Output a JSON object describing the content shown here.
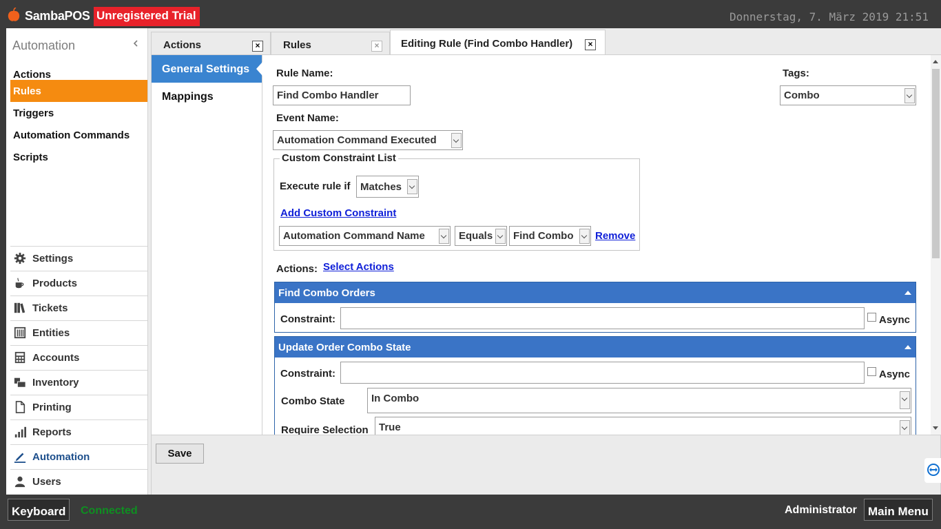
{
  "topbar": {
    "brand": "SambaPOS",
    "trial": "Unregistered Trial",
    "datetime": "Donnerstag, 7. März 2019 21:51"
  },
  "leftnav": {
    "title": "Automation",
    "items": [
      {
        "label": "Actions"
      },
      {
        "label": "Rules",
        "active": true
      },
      {
        "label": "Triggers"
      },
      {
        "label": "Automation Commands"
      },
      {
        "label": "Scripts"
      }
    ],
    "menu": [
      {
        "label": "Settings",
        "icon": "gear-icon"
      },
      {
        "label": "Products",
        "icon": "coffee-cup-icon"
      },
      {
        "label": "Tickets",
        "icon": "books-icon"
      },
      {
        "label": "Entities",
        "icon": "table-icon"
      },
      {
        "label": "Accounts",
        "icon": "calculator-icon"
      },
      {
        "label": "Inventory",
        "icon": "boxes-icon"
      },
      {
        "label": "Printing",
        "icon": "document-icon"
      },
      {
        "label": "Reports",
        "icon": "bar-chart-icon"
      },
      {
        "label": "Automation",
        "icon": "pencil-icon",
        "selected": true
      },
      {
        "label": "Users",
        "icon": "user-icon"
      }
    ]
  },
  "tabs": [
    {
      "label": "Actions"
    },
    {
      "label": "Rules"
    },
    {
      "label": "Editing Rule (Find Combo Handler)",
      "active": true
    }
  ],
  "subnav": [
    {
      "label": "General Settings",
      "active": true
    },
    {
      "label": "Mappings"
    }
  ],
  "form": {
    "rule_name_label": "Rule Name:",
    "rule_name": "Find Combo Handler",
    "tags_label": "Tags:",
    "tags_value": "Combo",
    "event_name_label": "Event Name:",
    "event_name": "Automation Command Executed",
    "constraint_group": {
      "title": "Custom Constraint List",
      "execute_label": "Execute rule if",
      "execute_value": "Matches",
      "add_link": "Add Custom Constraint",
      "constraint_field": "Automation Command Name",
      "constraint_op": "Equals",
      "constraint_value": "Find Combo",
      "remove_link": "Remove"
    },
    "actions_label": "Actions:",
    "select_actions_link": "Select Actions",
    "actions": [
      {
        "title": "Find Combo Orders",
        "constraint_label": "Constraint:",
        "constraint": "",
        "async_label": "Async"
      },
      {
        "title": "Update Order Combo State",
        "constraint_label": "Constraint:",
        "constraint": "",
        "async_label": "Async",
        "params": [
          {
            "label": "Combo State",
            "value": "In Combo"
          },
          {
            "label": "Require Selection",
            "value": "True"
          }
        ]
      }
    ],
    "save_label": "Save"
  },
  "bottombar": {
    "keyboard": "Keyboard",
    "status": "Connected",
    "user": "Administrator",
    "main_menu": "Main Menu"
  },
  "colors": {
    "accent_orange": "#f58b10",
    "trial_red": "#e8222a",
    "selected_blue": "#3a84d0",
    "action_header_blue": "#3a74c6",
    "connected_green": "#0e8f21"
  }
}
